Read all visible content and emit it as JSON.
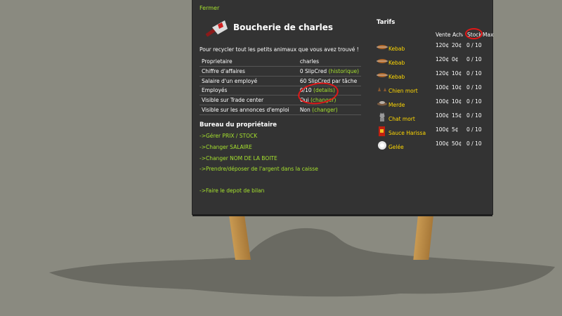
{
  "close": "Fermer",
  "shop": {
    "title": "Boucherie de charles",
    "description": "Pour recycler tout les petits animaux que vous avez trouvé !"
  },
  "info_rows": [
    {
      "label": "Proprietaire",
      "value": "charles",
      "link": ""
    },
    {
      "label": "Chiffre d'affaires",
      "value": "0 SlipCred ",
      "link": "(historique)"
    },
    {
      "label": "Salaire d'un employé",
      "value": "60 SlipCred par tâche",
      "link": ""
    },
    {
      "label": "Employés",
      "value": "0/10 ",
      "link": "(details)"
    },
    {
      "label": "Visible sur Trade center",
      "value": "Oui ",
      "link": "(changer)"
    },
    {
      "label": "Visible sur les annonces d'emploi",
      "value": "Non ",
      "link": "(changer)"
    }
  ],
  "office": {
    "title": "Bureau du propriétaire",
    "links": [
      "->Gérer PRIX / STOCK",
      "->Changer SALAIRE",
      "->Changer NOM DE LA BOITE",
      "->Prendre/déposer de l'argent dans la caisse",
      "->Faire le depot de bilan"
    ]
  },
  "tarifs": {
    "title": "Tarifs",
    "headers": [
      "Vente",
      "Achat",
      "Stock",
      "Max"
    ],
    "products": [
      {
        "name": "Kebab",
        "icon": "kebab-icon",
        "vente": "120¢",
        "achat": "20¢",
        "stock": "0 / 10"
      },
      {
        "name": "Kebab",
        "icon": "kebab-icon",
        "vente": "120¢",
        "achat": "0¢",
        "stock": "0 / 10"
      },
      {
        "name": "Kebab",
        "icon": "kebab-icon",
        "vente": "120¢",
        "achat": "10¢",
        "stock": "0 / 10"
      },
      {
        "name": "Chien mort",
        "icon": "dead-dog-icon",
        "vente": "100¢",
        "achat": "10¢",
        "stock": "0 / 10"
      },
      {
        "name": "Merde",
        "icon": "poop-icon",
        "vente": "100¢",
        "achat": "10¢",
        "stock": "0 / 10"
      },
      {
        "name": "Chat mort",
        "icon": "dead-cat-icon",
        "vente": "100¢",
        "achat": "15¢",
        "stock": "0 / 10"
      },
      {
        "name": "Sauce Harissa",
        "icon": "harissa-icon",
        "vente": "100¢",
        "achat": "5¢",
        "stock": "0 / 10"
      },
      {
        "name": "Gelée",
        "icon": "jelly-icon",
        "vente": "100¢",
        "achat": "50¢",
        "stock": "0 / 10"
      }
    ]
  },
  "colors": {
    "link": "#a6e22e",
    "product": "#ffd800",
    "panel": "#333333",
    "background": "#8a8a80",
    "highlight": "#e01818"
  }
}
